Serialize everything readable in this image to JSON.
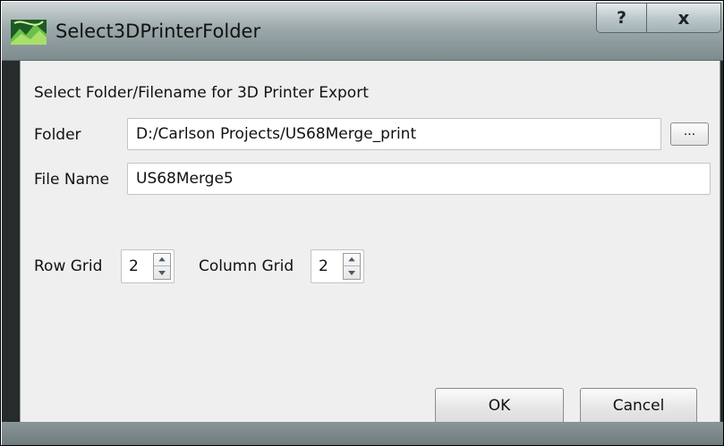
{
  "window": {
    "title": "Select3DPrinterFolder",
    "help_label": "?",
    "close_label": "x"
  },
  "dialog": {
    "heading": "Select Folder/Filename for 3D Printer Export",
    "folder_label": "Folder",
    "folder_value": "D:/Carlson Projects/US68Merge_print",
    "browse_label": "...",
    "filename_label": "File Name",
    "filename_value": "US68Merge5",
    "row_grid_label": "Row Grid",
    "row_grid_value": "2",
    "column_grid_label": "Column Grid",
    "column_grid_value": "2",
    "ok_label": "OK",
    "cancel_label": "Cancel"
  }
}
